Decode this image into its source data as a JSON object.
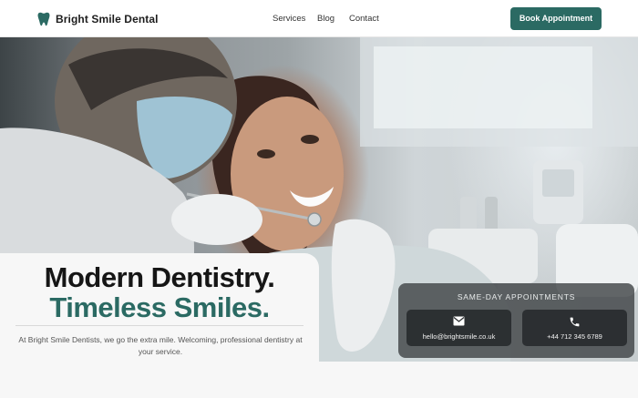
{
  "brand": {
    "name": "Bright Smile Dental",
    "logo_icon": "tooth-icon",
    "accent": "#2b6a63"
  },
  "nav": {
    "items": [
      {
        "label": "Services"
      },
      {
        "label": "Blog"
      },
      {
        "label": "Contact"
      }
    ]
  },
  "cta": {
    "label": "Book Appointment"
  },
  "hero": {
    "image_icon": "dentist-patient-photo",
    "headline_line1": "Modern Dentistry.",
    "headline_line2": "Timeless Smiles.",
    "tagline": "At Bright Smile Dentists, we go the extra mile. Welcoming, professional dentistry at your service."
  },
  "same_day": {
    "title": "SAME-DAY APPOINTMENTS",
    "email": {
      "icon": "mail-icon",
      "value": "hello@brightsmile.co.uk"
    },
    "phone": {
      "icon": "phone-icon",
      "value": "+44 712 345 6789"
    }
  }
}
